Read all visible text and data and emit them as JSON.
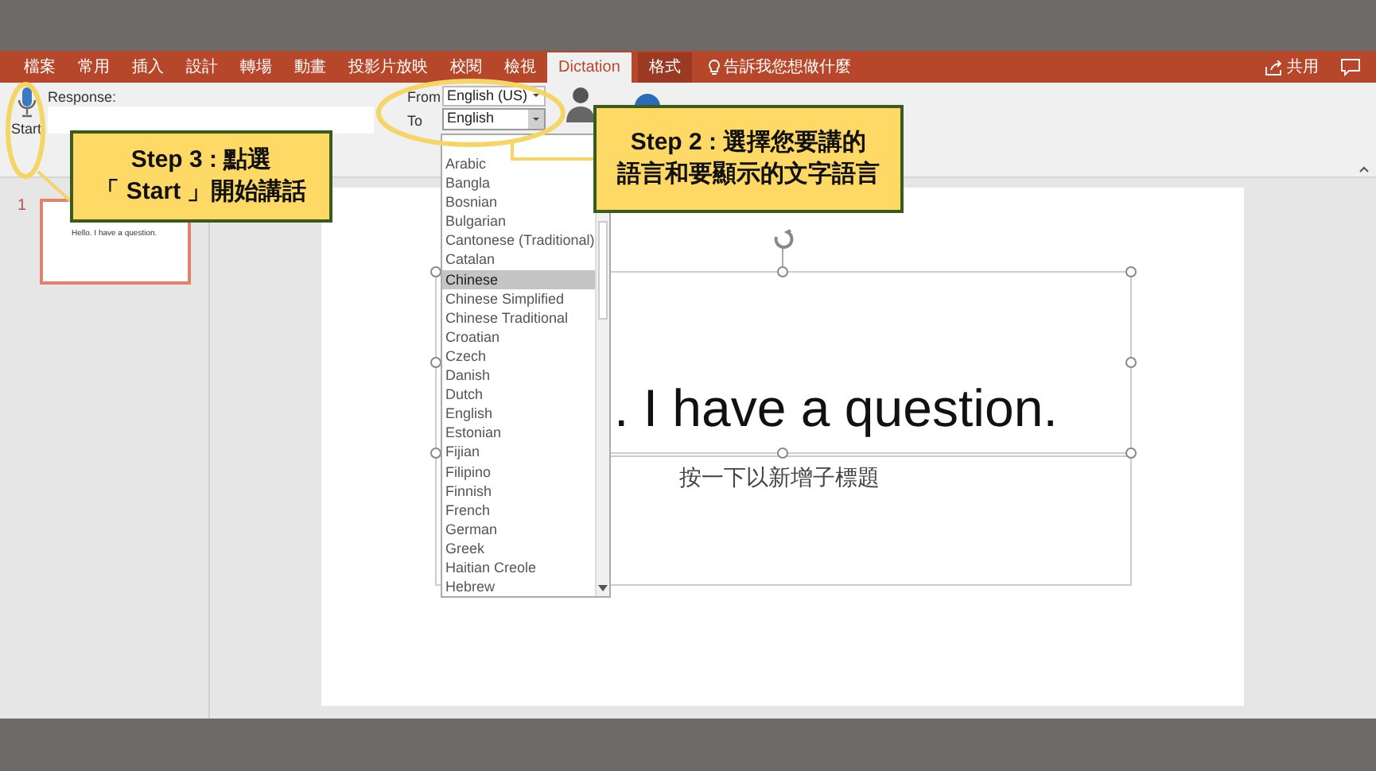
{
  "tabs": [
    {
      "label": "檔案",
      "selected": false,
      "contextual": false
    },
    {
      "label": "常用",
      "selected": false,
      "contextual": false
    },
    {
      "label": "插入",
      "selected": false,
      "contextual": false
    },
    {
      "label": "設計",
      "selected": false,
      "contextual": false
    },
    {
      "label": "轉場",
      "selected": false,
      "contextual": false
    },
    {
      "label": "動畫",
      "selected": false,
      "contextual": false
    },
    {
      "label": "投影片放映",
      "selected": false,
      "contextual": false
    },
    {
      "label": "校閱",
      "selected": false,
      "contextual": false
    },
    {
      "label": "檢視",
      "selected": false,
      "contextual": false
    },
    {
      "label": "Dictation",
      "selected": true,
      "contextual": false
    },
    {
      "label": "格式",
      "selected": false,
      "contextual": true
    }
  ],
  "tell_me": "告訴我您想做什麼",
  "share": "共用",
  "dictation": {
    "start": "Start",
    "response_label": "Response:",
    "from_label": "From",
    "from_value": "English (US)",
    "to_label": "To",
    "to_value": "English"
  },
  "language_list": [
    {
      "label": "Arabic",
      "selected": false
    },
    {
      "label": "Bangla",
      "selected": false
    },
    {
      "label": "Bosnian",
      "selected": false
    },
    {
      "label": "Bulgarian",
      "selected": false
    },
    {
      "label": "Cantonese (Traditional)",
      "selected": false
    },
    {
      "label": "Catalan",
      "selected": false
    },
    {
      "label": "Chinese",
      "selected": true
    },
    {
      "label": "Chinese Simplified",
      "selected": false
    },
    {
      "label": "Chinese Traditional",
      "selected": false
    },
    {
      "label": "Croatian",
      "selected": false
    },
    {
      "label": "Czech",
      "selected": false
    },
    {
      "label": "Danish",
      "selected": false
    },
    {
      "label": "Dutch",
      "selected": false
    },
    {
      "label": "English",
      "selected": false
    },
    {
      "label": "Estonian",
      "selected": false
    },
    {
      "label": "Fijian",
      "selected": false
    },
    {
      "label": "Filipino",
      "selected": false
    },
    {
      "label": "Finnish",
      "selected": false
    },
    {
      "label": "French",
      "selected": false
    },
    {
      "label": "German",
      "selected": false
    },
    {
      "label": "Greek",
      "selected": false
    },
    {
      "label": "Haitian Creole",
      "selected": false
    },
    {
      "label": "Hebrew",
      "selected": false
    }
  ],
  "slides_panel": {
    "number": "1",
    "thumbnail_text": "Hello. I have a question."
  },
  "slide": {
    "title": ". I have a question.",
    "subtitle_placeholder": "按一下以新增子標題"
  },
  "callouts": [
    {
      "lines": [
        "Step 3 : 點選",
        "「 Start 」開始講話"
      ]
    },
    {
      "lines": [
        "Step 2 : 選擇您要講的",
        "語言和要顯示的文字語言"
      ]
    }
  ]
}
